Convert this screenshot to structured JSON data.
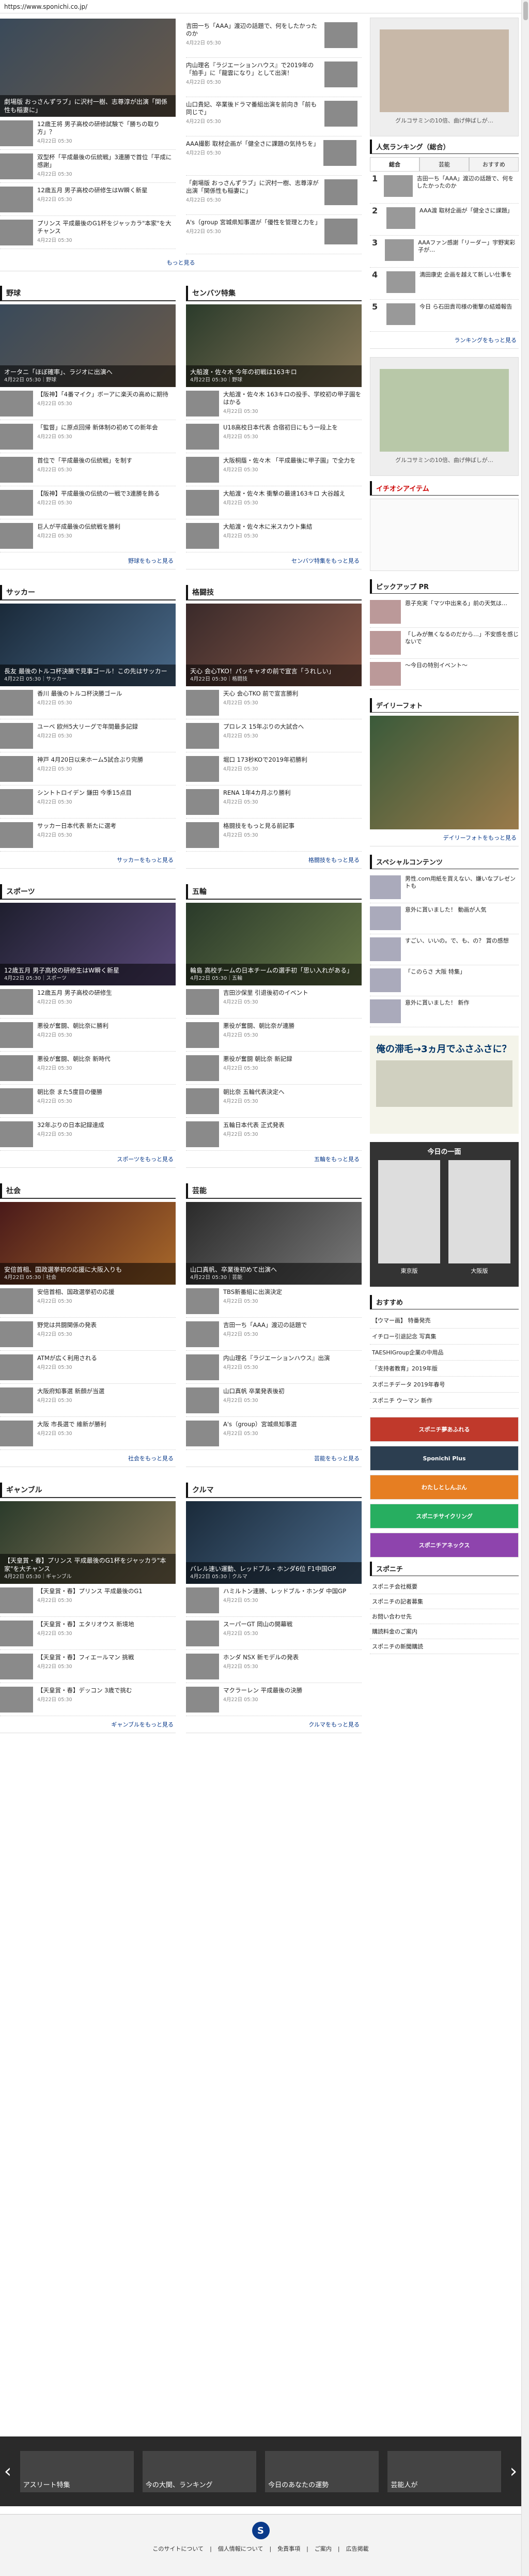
{
  "topbar": {
    "url": "https://www.sponichi.co.jp/"
  },
  "top": {
    "left": [
      {
        "title": "劇場版 おっさんずラブ」に沢村一樹、志尊淳が出演「関係性も稲妻に」",
        "hero": true
      },
      {
        "title": "12歳王将 男子高校の研修試験で「勝ちの取り方」？",
        "meta": "4月22日 05:30"
      },
      {
        "title": "双型杯「平成最後の伝統戦」3連勝で首位「平成に感謝」",
        "meta": "4月22日 05:30"
      },
      {
        "title": "12歳五月 男子高校の研修生はW瞬く新星",
        "meta": "4月22日 05:30"
      },
      {
        "title": "プリンス 平成最後のG1杯をジャッカラ\"本家\"を大チャンス",
        "meta": "4月22日 05:30"
      }
    ],
    "right": [
      {
        "title": "吉田一ち「AAA」渡辺の話題で、何をしたかったのか",
        "meta": "4月22日 05:30"
      },
      {
        "title": "内山理名『ラジエーションハウス』で2019年の「拍手」に「龍雲になり」として出演！",
        "meta": "4月22日 05:30"
      },
      {
        "title": "山口貴妃、卒業後ドラマ番組出演を前向き「前も同じで」",
        "meta": "4月22日 05:30"
      },
      {
        "title": "AAA撮影 取材企画が「健全さに課題の気持ちを」",
        "meta": "4月22日 05:30"
      },
      {
        "title": "「劇場版 おっさんずラブ」に沢村一樹、志尊淳が出演「関係性も稲妻に」",
        "meta": "4月22日 05:30"
      },
      {
        "title": "A's（group 宮城県知事選が「優性を管理と力を」",
        "meta": "4月22日 05:30"
      }
    ],
    "more": "もっと見る"
  },
  "sections": [
    {
      "left": {
        "title": "野球",
        "hero": "オータニ「ほぼ確率」、ラジオに出演へ",
        "hero_meta": "4月22日 05:30｜野球",
        "items": [
          "【阪神】「4番マイク」ボーアに楽天の高めに期待",
          "「監督」に原点回帰 新体制の初めての新年会",
          "首位で「平成最後の伝統戦」を制す",
          "【阪神】平成最後の伝統の一戦で3連勝を飾る",
          "巨人が平成最後の伝統戦を勝利"
        ],
        "more": "野球をもっと見る"
      },
      "right": {
        "title": "センバツ特集",
        "hero": "大船渡・佐々木 今年の初戦は163キロ",
        "hero_meta": "4月22日 05:30｜野球",
        "items": [
          "大船渡・佐々木 163キロの投手、学校初の甲子園をはかる",
          "U18高校日本代表 合宿初日にもう一段上を",
          "大阪桐蔭・佐々木 「平成最後に甲子園」で全力を",
          "大船渡・佐々木 衝撃の最速163キロ 大谷越え",
          "大船渡・佐々木に米スカウト集結"
        ],
        "more": "センバツ特集をもっと見る"
      }
    },
    {
      "left": {
        "title": "サッカー",
        "hero": "長友 最後のトルコ杯決勝で見事ゴール！この先はサッカー",
        "hero_meta": "4月22日 05:30｜サッカー",
        "items": [
          "香川 最後のトルコ杯決勝ゴール",
          "ユーベ 欧州5大リーグで年間最多記録",
          "神戸 4月20日以来ホーム5試合ぶり完勝",
          "シントトロイデン 鎌田 今季15点目",
          "サッカー日本代表 新たに選考"
        ],
        "more": "サッカーをもっと見る"
      },
      "right": {
        "title": "格闘技",
        "hero": "天心 会心TKO！パッキャオの前で宣言「うれしい」",
        "hero_meta": "4月22日 05:30｜格闘技",
        "items": [
          "天心 会心TKO 前で宣言勝利",
          "プロレス 15年ぶりの大試合へ",
          "堀口 173秒KOで2019年初勝利",
          "RENA 1年4カ月ぶり勝利",
          "格闘技をもっと見る前記事"
        ],
        "more": "格闘技をもっと見る"
      }
    },
    {
      "left": {
        "title": "スポーツ",
        "hero": "12歳五月 男子高校の研修生はW瞬く新星",
        "hero_meta": "4月22日 05:30｜スポーツ",
        "items": [
          "12歳五月 男子高校の研修生",
          "悪役が奮闘、朝比奈に勝利",
          "悪役が奮闘、朝比奈 新時代",
          "朝比奈 また5度目の優勝",
          "32年ぶりの日本記録達成"
        ],
        "more": "スポーツをもっと見る"
      },
      "right": {
        "title": "五輪",
        "hero": "輪島 高校チームの日本チームの選手初「思い入れがある」",
        "hero_meta": "4月22日 05:30｜五輪",
        "items": [
          "吉田沙保里 引退後初のイベント",
          "悪役が奮闘、朝比奈が連勝",
          "悪役が奮闘 朝比奈 新記録",
          "朝比奈 五輪代表決定へ",
          "五輪日本代表 正式発表"
        ],
        "more": "五輪をもっと見る"
      }
    },
    {
      "left": {
        "title": "社会",
        "hero": "安倍首相、国政選挙初の応援に大阪入りも",
        "hero_meta": "4月22日 05:30｜社会",
        "items": [
          "安倍首相、国政選挙初の応援",
          "野党は共闘関係の発表",
          "ATMが広く利用される",
          "大阪府知事選 新顔が当選",
          "大阪 市長選で 維新が勝利"
        ],
        "more": "社会をもっと見る"
      },
      "right": {
        "title": "芸能",
        "hero": "山口真帆、卒業後初めて出演へ",
        "hero_meta": "4月22日 05:30｜芸能",
        "items": [
          "TBS新番組に出演決定",
          "吉田一ち「AAA」渡辺の話題で",
          "内山理名『ラジエーションハウス』出演",
          "山口真帆 卒業発表後初",
          "A's（group）宮城県知事選"
        ],
        "more": "芸能をもっと見る"
      }
    },
    {
      "left": {
        "title": "ギャンブル",
        "hero": "【天皇賞・春】プリンス 平成最後のG1杯をジャッカラ\"本家\"を大チャンス",
        "hero_meta": "4月22日 05:30｜ギャンブル",
        "items": [
          "【天皇賞・春】プリンス 平成最後のG1",
          "【天皇賞・春】エタリオウス 新境地",
          "【天皇賞・春】フィエールマン 挑戦",
          "【天皇賞・春】デッコン 3歳で挑む"
        ],
        "more": "ギャンブルをもっと見る"
      },
      "right": {
        "title": "クルマ",
        "hero": "バレル速い運動、レッドブル・ホンダ6位 F1中国GP",
        "hero_meta": "4月22日 05:30｜クルマ",
        "items": [
          "ハミルトン連勝、レッドブル・ホンダ 中国GP",
          "スーパーGT 岡山の開幕戦",
          "ホンダ NSX 新モデルの発表",
          "マクラーレン 平成最後の決勝"
        ],
        "more": "クルマをもっと見る"
      }
    }
  ],
  "side": {
    "ad1": "グルコサミンの10倍、曲げ伸ばしが…",
    "ranking_title": "人気ランキング（総合）",
    "ranking_tabs": [
      "総合",
      "芸能",
      "おすすめ"
    ],
    "ranking": [
      {
        "n": "1",
        "t": "吉田一ち「AAA」渡辺の話題で、何をしたかったのか"
      },
      {
        "n": "2",
        "t": "AAA渡 取材企画が「健全さに課題」"
      },
      {
        "n": "3",
        "t": "AAAファン感謝「リーダー」宇野実彩子が…"
      },
      {
        "n": "4",
        "t": "満田康史 企画を越えて新しい仕事を"
      },
      {
        "n": "5",
        "t": "今日 ら石田貴司様の衝撃の結婚報告"
      }
    ],
    "ranking_more": "ランキングをもっと見る",
    "ad2": "グルコサミンの10倍、曲げ伸ばしが…",
    "recommend_title": "イチオシアイテム",
    "pickup_title": "ピックアップ PR",
    "pickup": [
      "恩子充実「マツ中出来る」前の天気は…",
      "「しみが無くなるのだから…」不安感を感じないで",
      "〜今日の特別イベント〜"
    ],
    "daily_title": "デイリーフォト",
    "daily_more": "デイリーフォトをもっと見る",
    "special_title": "スペシャルコンテンツ",
    "special": [
      "男性.com用紙を買えない、嫌いなプレゼントも",
      "意外に貰いました！ 動画が人気",
      "すごい、いいの。で、も、の？ 賞の感想",
      "「このらさ 大阪 特集」",
      "意外に貰いました！ 新作"
    ],
    "ad3_title": "俺の滞毛→3ヵ月でふさふさに？",
    "newspaper_title": "今日の一面",
    "newspaper": [
      "東京版",
      "大阪版"
    ],
    "osusume_title": "おすすめ",
    "osusume": [
      "【ウマー画】 特番発売",
      "イチロー引退記念 写真集",
      "TAESHIGroup企業の中用品",
      "「支持者教育」2019年版",
      "スポニチデータ 2019年春号",
      "スポニチ ウーマン 新作"
    ],
    "banners": [
      "スポニチ夢あふれる",
      "Sponichi Plus",
      "わたしとしんぶん",
      "スポニチサイクリング",
      "スポニチアネックス"
    ],
    "sponichi_title": "スポニチ",
    "sponichi_links": [
      "スポニチ会社概要",
      "スポニチの記者募集",
      "お問い合わせ先",
      "購読料金のご案内",
      "スポニチの新聞購読"
    ]
  },
  "carousel": {
    "items": [
      "アスリート特集",
      "今の大関、ランキング",
      "今日のあなたの運勢",
      "芸能人が"
    ]
  },
  "footer": {
    "links": [
      "このサイトについて",
      "個人情報について",
      "免責事項",
      "ご案内",
      "広告掲載"
    ],
    "logo": "S"
  }
}
